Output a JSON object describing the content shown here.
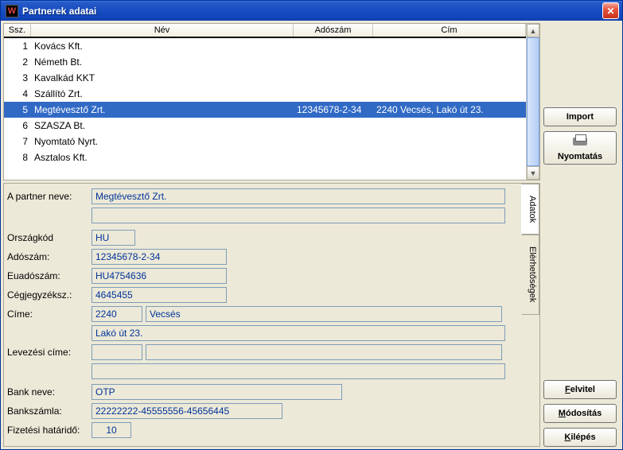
{
  "window": {
    "title": "Partnerek adatai",
    "app_icon_letter": "W",
    "close_x": "✕"
  },
  "table": {
    "headers": {
      "ssz": "Ssz.",
      "nev": "Név",
      "adoszam": "Adószám",
      "cim": "Cím"
    },
    "rows": [
      {
        "ssz": "1",
        "nev": "Kovács Kft.",
        "adoszam": "",
        "cim": ""
      },
      {
        "ssz": "2",
        "nev": "Németh Bt.",
        "adoszam": "",
        "cim": ""
      },
      {
        "ssz": "3",
        "nev": "Kavalkád KKT",
        "adoszam": "",
        "cim": ""
      },
      {
        "ssz": "4",
        "nev": "Szállító Zrt.",
        "adoszam": "",
        "cim": ""
      },
      {
        "ssz": "5",
        "nev": "Megtévesztő Zrt.",
        "adoszam": "12345678-2-34",
        "cim": "2240 Vecsés, Lakó út 23."
      },
      {
        "ssz": "6",
        "nev": "SZASZA Bt.",
        "adoszam": "",
        "cim": ""
      },
      {
        "ssz": "7",
        "nev": "Nyomtató Nyrt.",
        "adoszam": "",
        "cim": ""
      },
      {
        "ssz": "8",
        "nev": "Asztalos Kft.",
        "adoszam": "",
        "cim": ""
      }
    ],
    "selected_index": 4
  },
  "form": {
    "labels": {
      "partner_neve": "A partner neve:",
      "orszagkod": "Országkód",
      "adoszam": "Adószám:",
      "euadoszam": "Euadószám:",
      "cegjegyzeksz": "Cégjegyzéksz.:",
      "cime": "Címe:",
      "levelezesi": "Levezési címe:",
      "bank_neve": "Bank neve:",
      "bankszamla": "Bankszámla:",
      "fizetesi": "Fizetési határidő:"
    },
    "values": {
      "partner_neve": "Megtévesztő Zrt.",
      "partner_neve2": "",
      "orszagkod": "HU",
      "adoszam": "12345678-2-34",
      "euadoszam": "HU4754636",
      "cegjegyzeksz": "4645455",
      "irsz": "2240",
      "varos": "Vecsés",
      "utca": "Lakó út 23.",
      "lev_irsz": "",
      "lev_varos": "",
      "lev_utca": "",
      "bank_neve": "OTP",
      "bankszamla": "22222222-45555556-45656445",
      "fizetesi": "10"
    },
    "tabs": {
      "adatok": "Adatok",
      "elerhetosegek": "Elérhetőségek"
    }
  },
  "buttons": {
    "import": "Import",
    "nyomtatas": "Nyomtatás",
    "felvitel": "Felvitel",
    "modositas": "Módosítás",
    "kilepes": "Kilépés"
  }
}
